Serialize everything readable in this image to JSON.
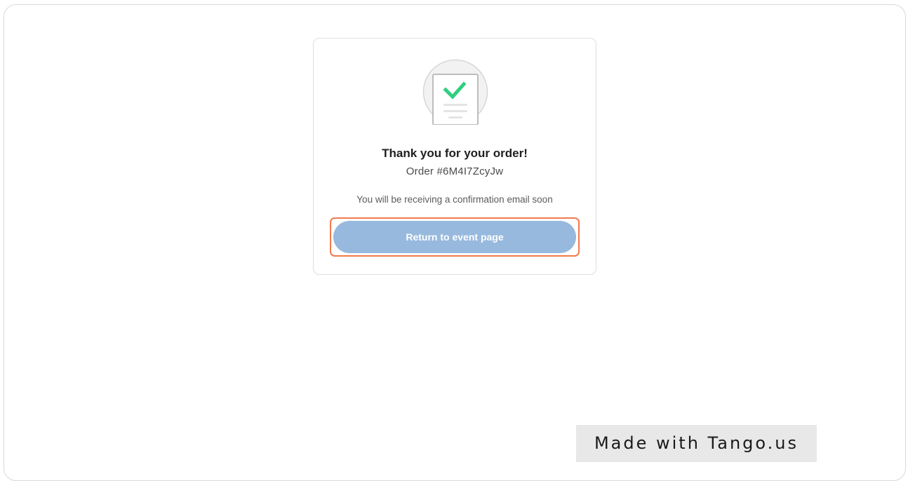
{
  "confirmation": {
    "title": "Thank you for your order!",
    "order_label": "Order #6M4I7ZcyJw",
    "note": "You will be receiving a confirmation email soon",
    "illustration_icon": "order-confirmed-icon"
  },
  "actions": {
    "return_label": "Return to event page"
  },
  "watermark": {
    "text": "Made with Tango.us"
  },
  "colors": {
    "button": "#97b9de",
    "highlight": "#f07a4e",
    "check": "#2fcf7e"
  }
}
